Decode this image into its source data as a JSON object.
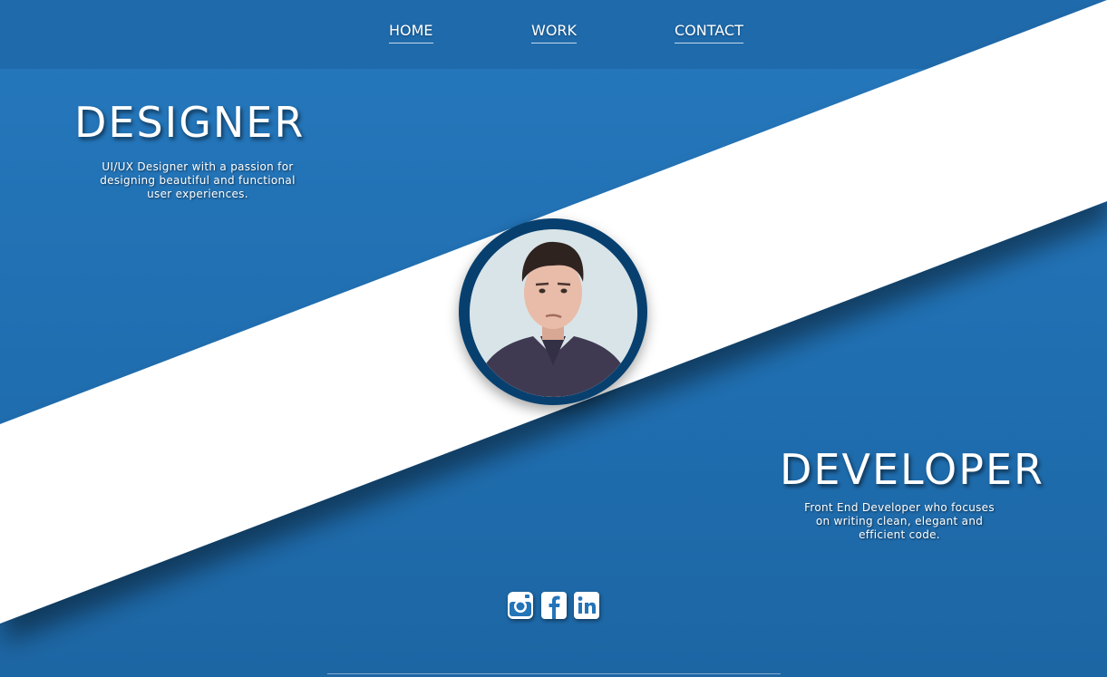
{
  "nav": {
    "items": [
      {
        "label": "HOME"
      },
      {
        "label": "WORK"
      },
      {
        "label": "CONTACT"
      }
    ]
  },
  "designer": {
    "title": "DESIGNER",
    "description_lines": [
      "UI/UX Designer with a passion for",
      "designing beautiful and functional",
      "user experiences."
    ]
  },
  "developer": {
    "title": "DEVELOPER",
    "description_lines": [
      "Front End Developer who focuses",
      "on writing clean, elegant and",
      "efficient code."
    ]
  },
  "social": {
    "icons": [
      "instagram-icon",
      "facebook-icon",
      "linkedin-icon"
    ]
  },
  "colors": {
    "background": "#2474b8",
    "navbar": "#1f6aab",
    "stripe": "#ffffff",
    "avatar_ring": "#07406f",
    "text": "#ffffff"
  }
}
